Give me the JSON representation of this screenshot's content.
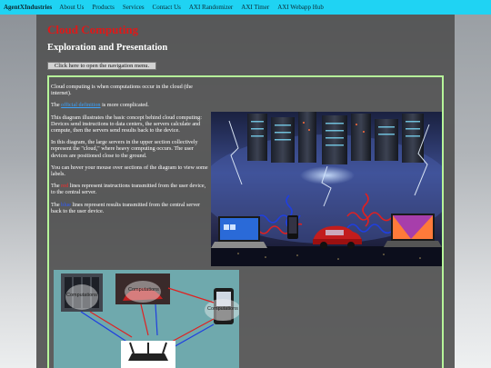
{
  "navbar": {
    "brand": "AgentXIndustries",
    "links": [
      "About Us",
      "Products",
      "Services",
      "Contact Us",
      "AXI Randomizer",
      "AXI Timer",
      "AXI Webapp Hub"
    ]
  },
  "page": {
    "title": "Cloud Computing",
    "subtitle": "Exploration and Presentation",
    "menu_button": "Click here to open the navigation menu."
  },
  "content": {
    "p1": "Cloud computing is when computations occur in the cloud (the internet).",
    "p2_pre": "The ",
    "p2_link": "official definition",
    "p2_post": " is more complicated.",
    "p3": "This diagram illustrates the basic concept behind cloud computing: Devices send instructions to data centers, the servers calculate and compute, then the servers send results back to the device.",
    "p4": "In this diagram, the large servers in the upper section collectively represent the \"cloud,\" where heavy computing occurs. The user devices are positioned close to the ground.",
    "p5": "You can hover your mouse over sections of the diagram to view some labels.",
    "p6_pre": "The ",
    "p6_word": "red",
    "p6_post": " lines represent instructions transmitted from the user device, to the central server.",
    "p7_pre": "The ",
    "p7_word": "blue",
    "p7_post": " lines represent results transmitted from the central server back to the user device."
  },
  "diagram_small": {
    "labels": [
      "Computations",
      "Computations",
      "Computations"
    ]
  },
  "colors": {
    "navbar": "#1fd3f3",
    "title": "#e01818",
    "border": "#b6f59a",
    "red_line": "#e02020",
    "blue_line": "#1f3fe0"
  }
}
